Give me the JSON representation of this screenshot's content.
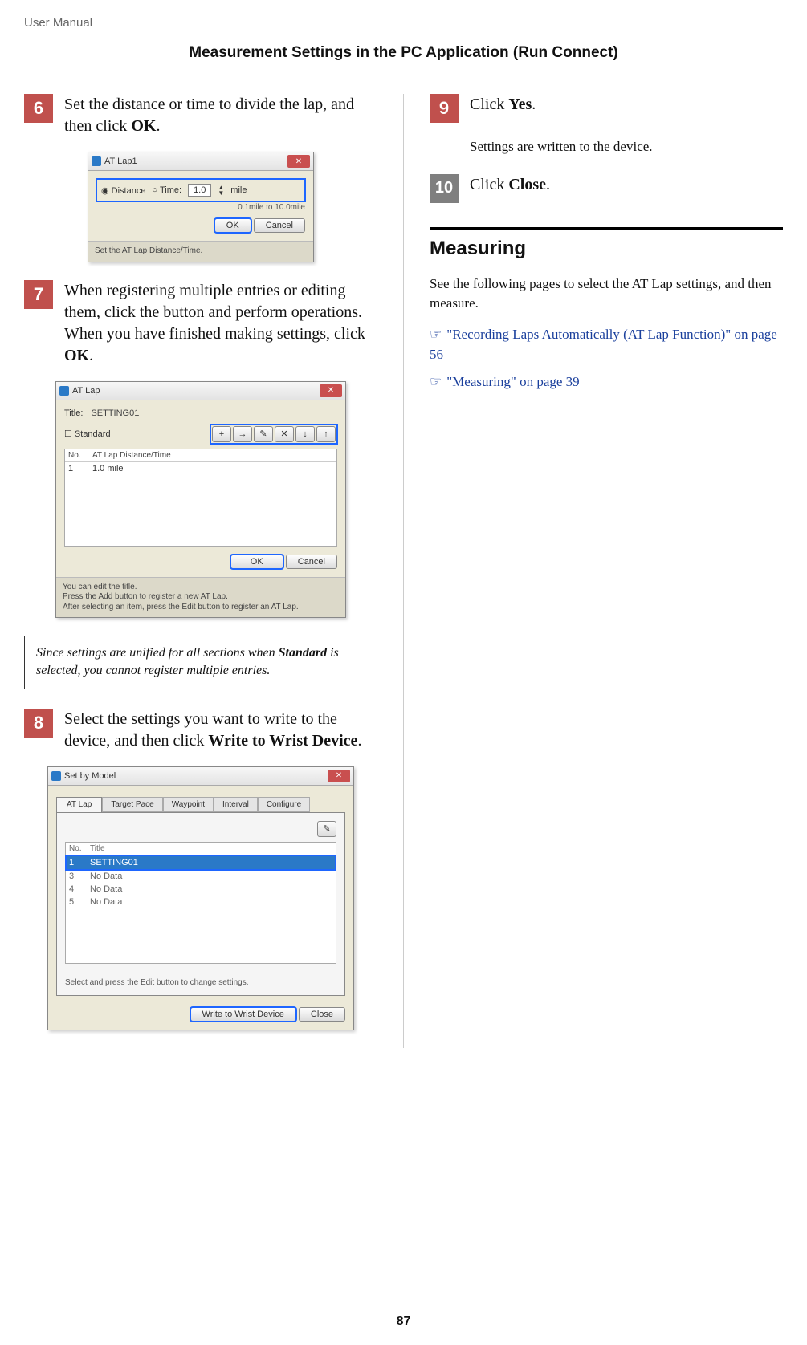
{
  "header": {
    "doc_label": "User Manual",
    "chapter": "Measurement Settings in the PC Application (Run Connect)"
  },
  "left": {
    "step6": {
      "num": "6",
      "text_a": "Set the distance or time to divide the lap, and then click ",
      "bold": "OK",
      "text_b": "."
    },
    "fig6": {
      "title": "AT Lap1",
      "radio_distance": "Distance",
      "radio_time": "Time:",
      "value": "1.0",
      "unit": "mile",
      "range": "0.1mile to 10.0mile",
      "ok": "OK",
      "cancel": "Cancel",
      "help": "Set the AT Lap Distance/Time."
    },
    "step7": {
      "num": "7",
      "line1": "When registering multiple entries or editing them, click the button and perform operations.",
      "line2a": "When you have finished making settings, click ",
      "bold": "OK",
      "line2b": "."
    },
    "fig7": {
      "title": "AT Lap",
      "title_label": "Title:",
      "title_value": "SETTING01",
      "standard": "Standard",
      "col_no": "No.",
      "col_dt": "AT Lap Distance/Time",
      "row1_no": "1",
      "row1_dt": "1.0 mile",
      "ok": "OK",
      "cancel": "Cancel",
      "help1": "You can edit the title.",
      "help2": "Press the Add button to register a new AT Lap.",
      "help3": "After selecting an item, press the Edit button to register an AT Lap.",
      "btn_add": "+",
      "btn_right": "→",
      "btn_edit": "✎",
      "btn_del": "✕",
      "btn_down": "↓",
      "btn_up": "↑"
    },
    "note": {
      "a": "Since settings are unified for all sections when ",
      "b": "Standard",
      "c": " is selected, you cannot register multiple entries."
    },
    "step8": {
      "num": "8",
      "text_a": "Select the settings you want to write to the device, and then click ",
      "bold": "Write to Wrist Device",
      "text_b": "."
    },
    "fig8": {
      "title": "Set by Model",
      "tab_atlap": "AT Lap",
      "tab_target": "Target Pace",
      "tab_waypoint": "Waypoint",
      "tab_interval": "Interval",
      "tab_config": "Configure",
      "col_no": "No.",
      "col_title": "Title",
      "row1_no": "1",
      "row1_title": "SETTING01",
      "row_nodata": "No Data",
      "r3": "3",
      "r4": "4",
      "r5": "5",
      "edit_icon": "✎",
      "help": "Select and press the Edit button to change settings.",
      "write": "Write to Wrist Device",
      "close": "Close"
    }
  },
  "right": {
    "step9": {
      "num": "9",
      "text_a": "Click ",
      "bold": "Yes",
      "text_b": ".",
      "sub": "Settings are written to the device."
    },
    "step10": {
      "num": "10",
      "text_a": "Click ",
      "bold": "Close",
      "text_b": "."
    },
    "section_head": "Measuring",
    "body": "See the following pages to select the AT Lap settings, and then measure.",
    "xref_icon": "☞",
    "xref1": "\"Recording Laps Automatically (AT Lap Function)\" on page 56",
    "xref2": "\"Measuring\" on page 39"
  },
  "page_number": "87"
}
